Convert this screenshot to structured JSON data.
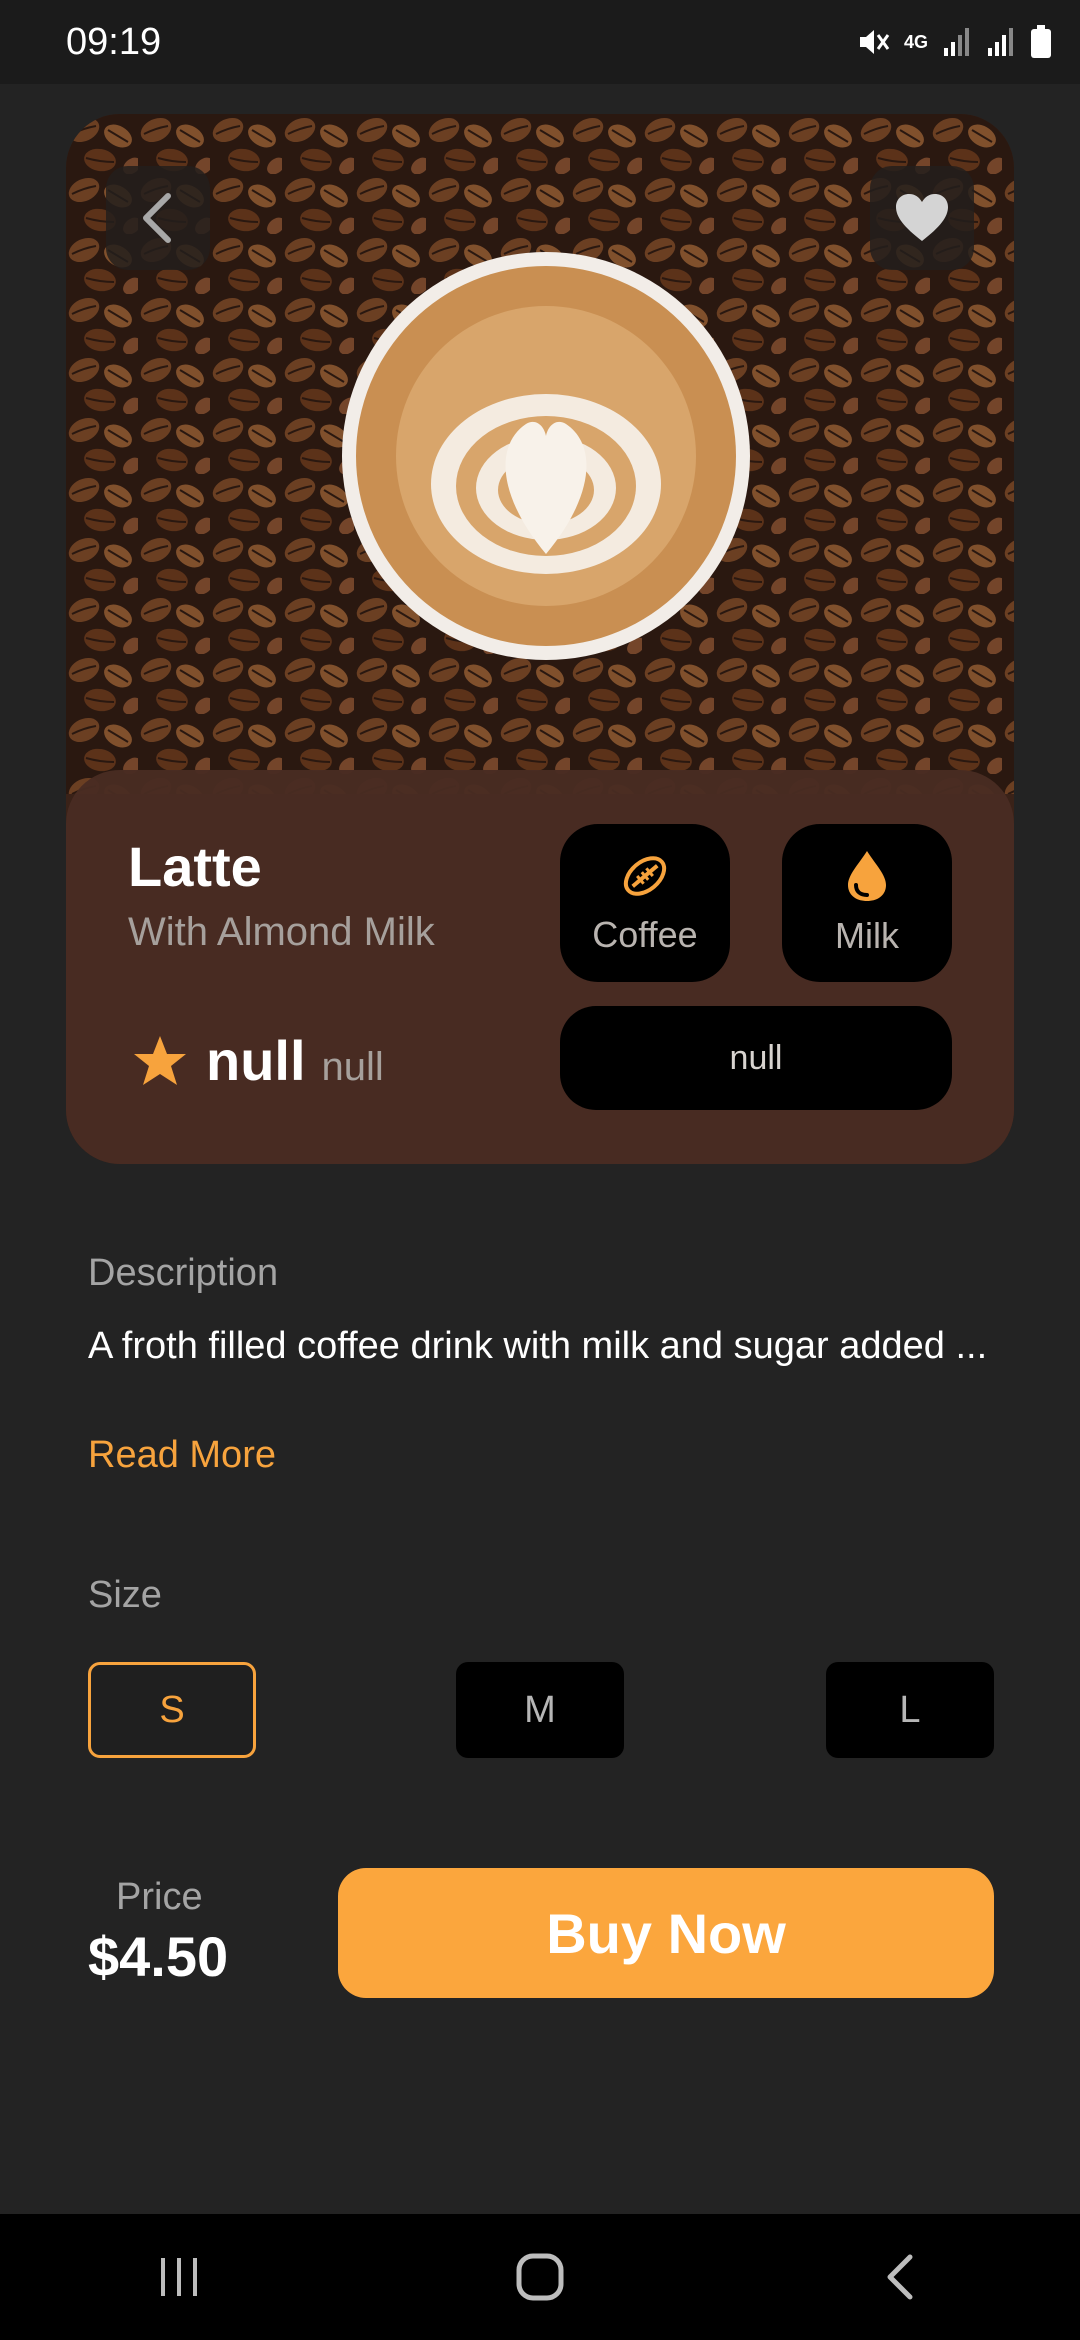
{
  "status_bar": {
    "time": "09:19",
    "network": "4G"
  },
  "product": {
    "name": "Latte",
    "subtitle": "With Almond Milk",
    "ingredients": [
      {
        "label": "Coffee",
        "icon": "football-bean-icon"
      },
      {
        "label": "Milk",
        "icon": "drop-icon"
      }
    ],
    "rating": "null",
    "rating_count": "null",
    "roast": "null"
  },
  "description": {
    "heading": "Description",
    "text": "A froth filled coffee drink with milk and sugar added ...",
    "read_more": "Read More"
  },
  "size": {
    "heading": "Size",
    "options": [
      "S",
      "M",
      "L"
    ],
    "selected": "S"
  },
  "price": {
    "label": "Price",
    "value": "$4.50"
  },
  "buy_button": "Buy Now",
  "colors": {
    "accent": "#fba63d",
    "background": "#232323",
    "panel": "#492c22",
    "chip": "#000000"
  }
}
